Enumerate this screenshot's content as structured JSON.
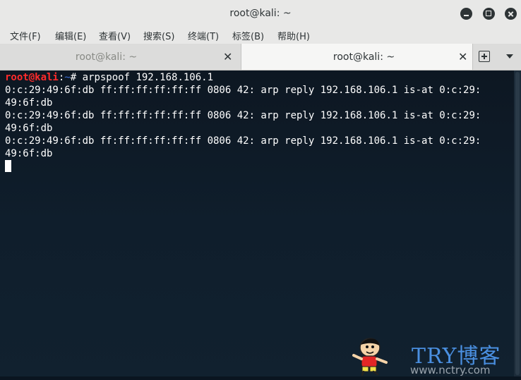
{
  "window": {
    "title": "root@kali: ~"
  },
  "menubar": {
    "items": [
      "文件(F)",
      "编辑(E)",
      "查看(V)",
      "搜索(S)",
      "终端(T)",
      "标签(B)",
      "帮助(H)"
    ]
  },
  "tabs": [
    {
      "label": "root@kali: ~",
      "active": false
    },
    {
      "label": "root@kali: ~",
      "active": true
    }
  ],
  "terminal": {
    "prompt_user": "root@kali",
    "prompt_sep": ":",
    "prompt_path": "~",
    "prompt_symbol": "# ",
    "command": "arpspoof 192.168.106.1",
    "output_lines": [
      "0:c:29:49:6f:db ff:ff:ff:ff:ff:ff 0806 42: arp reply 192.168.106.1 is-at 0:c:29:",
      "49:6f:db",
      "0:c:29:49:6f:db ff:ff:ff:ff:ff:ff 0806 42: arp reply 192.168.106.1 is-at 0:c:29:",
      "49:6f:db",
      "0:c:29:49:6f:db ff:ff:ff:ff:ff:ff 0806 42: arp reply 192.168.106.1 is-at 0:c:29:",
      "49:6f:db"
    ]
  },
  "watermark": {
    "brand": "TRY博客",
    "url": "www.nctry.com"
  },
  "colors": {
    "prompt_user": "#ff2b2b",
    "prompt_path": "#3b6fd8",
    "terminal_bg": "#0f1e2c",
    "chrome_bg": "#e8e8e7"
  },
  "icons": [
    "minimize-icon",
    "maximize-icon",
    "close-icon",
    "tab-close-icon",
    "new-tab-icon",
    "tab-menu-icon"
  ]
}
